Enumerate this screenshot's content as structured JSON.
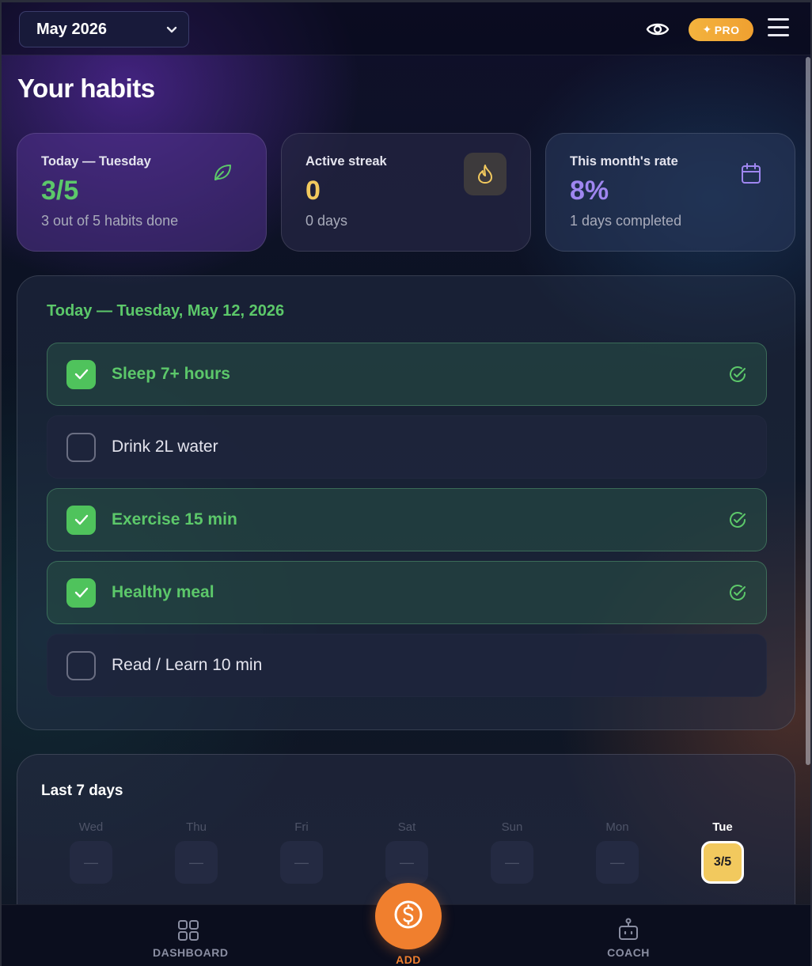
{
  "header": {
    "month": "May 2026",
    "pro_label": "PRO",
    "pro_star": "✦"
  },
  "page_title": "Your habits",
  "stats": {
    "today": {
      "label": "Today — Tuesday",
      "value": "3/5",
      "sub": "3 out of 5 habits done",
      "color": "#5cc86a",
      "icon": "leaf-icon"
    },
    "streak": {
      "label": "Active streak",
      "value": "0",
      "sub": "0 days",
      "color": "#f2c95e",
      "icon": "flame-icon"
    },
    "rate": {
      "label": "This month's rate",
      "value": "8%",
      "sub": "1 days completed",
      "color": "#9f86f0",
      "icon": "calendar-icon"
    }
  },
  "today_panel": {
    "heading": "Today — Tuesday, May 12, 2026",
    "habits": [
      {
        "name": "Sleep 7+ hours",
        "done": true
      },
      {
        "name": "Drink 2L water",
        "done": false
      },
      {
        "name": "Exercise 15 min",
        "done": true
      },
      {
        "name": "Healthy meal",
        "done": true
      },
      {
        "name": "Read / Learn 10 min",
        "done": false
      }
    ]
  },
  "week": {
    "heading": "Last 7 days",
    "days": [
      {
        "name": "Wed",
        "value": "—"
      },
      {
        "name": "Thu",
        "value": "—"
      },
      {
        "name": "Fri",
        "value": "—"
      },
      {
        "name": "Sat",
        "value": "—"
      },
      {
        "name": "Sun",
        "value": "—"
      },
      {
        "name": "Mon",
        "value": "—"
      },
      {
        "name": "Tue",
        "value": "3/5",
        "current": true
      }
    ]
  },
  "nav": {
    "dashboard": "DASHBOARD",
    "add": "ADD",
    "coach": "COACH"
  },
  "colors": {
    "accent_green": "#4fc35c",
    "accent_orange": "#f07f2e",
    "pro_gold": "#f3b33e"
  }
}
